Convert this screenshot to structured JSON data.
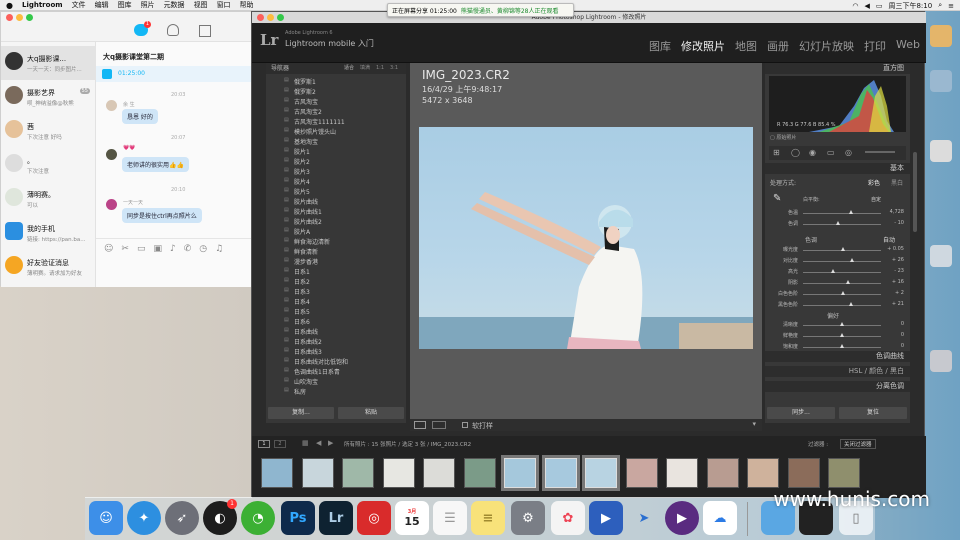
{
  "menubar": {
    "app": "Lightroom",
    "items": [
      "文件",
      "编辑",
      "图库",
      "照片",
      "元数据",
      "视图",
      "窗口",
      "帮助"
    ],
    "clock": "周三下午8:10"
  },
  "banner": {
    "text": "正在屏幕分享 01:25:00",
    "highlight": "熊猫慢通员、黄柳锦等28人正在观看"
  },
  "qq": {
    "contacts": [
      {
        "name": "大q摄影课...",
        "preview": "一天一天：同步图片...",
        "badge": ""
      },
      {
        "name": "摄影艺界",
        "preview": "呗_神纳溢像@秋熊",
        "badge": "55"
      },
      {
        "name": "茜",
        "preview": "下次注意 好吗",
        "badge": ""
      },
      {
        "name": "。",
        "preview": "下次注意",
        "badge": ""
      },
      {
        "name": "薄明赛。",
        "preview": "可以",
        "badge": ""
      },
      {
        "name": "我的手机",
        "preview": "链接: https://pan.ba...",
        "badge": ""
      },
      {
        "name": "好友验证消息",
        "preview": "薄明赛。请求加为好友",
        "badge": ""
      }
    ],
    "chat": {
      "title": "大q摄影课堂第二期",
      "share_time": "01:25:00",
      "messages": [
        {
          "time": "20:03",
          "sender": "余 生",
          "text": "恳恩 好的"
        },
        {
          "time": "20:07",
          "sender": "💗💗",
          "text": "老师讲的很实用👍👍"
        },
        {
          "time": "20:10",
          "sender": "一天一天",
          "text": "同步是按住ctrl再点照片么"
        }
      ]
    }
  },
  "lr": {
    "window_title": "Adobe Photoshop Lightroom - 修改照片",
    "identity_small": "Adobe Lightroom 6",
    "identity": "Lightroom mobile 入门",
    "modules": [
      "图库",
      "修改照片",
      "地图",
      "画册",
      "幻灯片放映",
      "打印",
      "Web"
    ],
    "active_module": "修改照片",
    "left": {
      "navigator": "导航器",
      "nav_opts": [
        "适合",
        "填满",
        "1:1",
        "3:1"
      ],
      "presets": [
        "俄罗斯1",
        "俄罗斯2",
        "古风淘宝",
        "古风淘宝2",
        "古风淘宝1111111",
        "模抄照片馒头山",
        "基地淘宝",
        "胶片1",
        "胶片2",
        "胶片3",
        "胶片4",
        "胶片5",
        "胶片曲线",
        "胶片曲线1",
        "胶片曲线2",
        "胶片A",
        "鲜食海边清新",
        "鲜食清新",
        "漫步香港",
        "日系1",
        "日系2",
        "日系3",
        "日系4",
        "日系5",
        "日系6",
        "日系曲线",
        "日系曲线2",
        "日系曲线3",
        "日系曲线对比低饱和",
        "色调曲线1日系青",
        "山吹淘宝",
        "私房"
      ],
      "copy_btn": "复制...",
      "paste_btn": "粘贴"
    },
    "photo": {
      "filename": "IMG_2023.CR2",
      "datetime": "16/4/29 上午9:48:17",
      "dimensions": "5472 x 3648"
    },
    "toolbar": {
      "soft_proof": "软打样"
    },
    "right": {
      "histogram": "直方图",
      "rgb": {
        "r": "76.3",
        "g": "77.6",
        "b": "85.4"
      },
      "original": "原始照片",
      "basic": "基本",
      "treatment_label": "处理方式:",
      "treatment_color": "彩色",
      "treatment_bw": "黑白",
      "wb_label": "白平衡:",
      "wb_value": "自定",
      "sliders_wb": [
        {
          "label": "色温",
          "value": "4,728",
          "pos": 0.62
        },
        {
          "label": "色调",
          "value": "- 10",
          "pos": 0.45
        }
      ],
      "tone_label": "色调",
      "tone_auto": "自动",
      "sliders_tone": [
        {
          "label": "曝光度",
          "value": "+ 0.05",
          "pos": 0.51
        },
        {
          "label": "对比度",
          "value": "+ 26",
          "pos": 0.63
        },
        {
          "label": "高光",
          "value": "- 23",
          "pos": 0.39
        },
        {
          "label": "阴影",
          "value": "+ 16",
          "pos": 0.58
        },
        {
          "label": "白色色阶",
          "value": "+ 2",
          "pos": 0.51
        },
        {
          "label": "黑色色阶",
          "value": "+ 21",
          "pos": 0.61
        }
      ],
      "presence_label": "偏好",
      "sliders_presence": [
        {
          "label": "清晰度",
          "value": "0",
          "pos": 0.5
        },
        {
          "label": "鲜艳度",
          "value": "0",
          "pos": 0.5
        },
        {
          "label": "饱和度",
          "value": "0",
          "pos": 0.5
        }
      ],
      "tone_curve": "色调曲线",
      "hsl": "HSL / 颜色 / 黑白",
      "split": "分离色调",
      "sync_btn": "同步...",
      "reset_btn": "复位"
    },
    "filmstrip": {
      "source": "所有照片 : 15 张照片 / 选定 3 张 / IMG_2023.CR2",
      "filter_label": "过滤器 :",
      "filter_value": "关闭过滤器",
      "pages": [
        "1",
        "2"
      ]
    }
  },
  "dock": {
    "apps": [
      "finder",
      "safari",
      "launchpad",
      "qq",
      "wechat",
      "photoshop",
      "lightroom",
      "netease-music",
      "calendar",
      "reminders",
      "notes",
      "system-preferences",
      "photos",
      "photo-slideshow",
      "feishu",
      "video-player",
      "baidu-netdisk"
    ],
    "calendar_day": "15",
    "calendar_month": "3月",
    "qq_badge": "1"
  },
  "watermark": "www.hunis.com",
  "colors": {
    "lr_bg": "#2b2b2b",
    "qq_accent": "#12b7f5"
  }
}
